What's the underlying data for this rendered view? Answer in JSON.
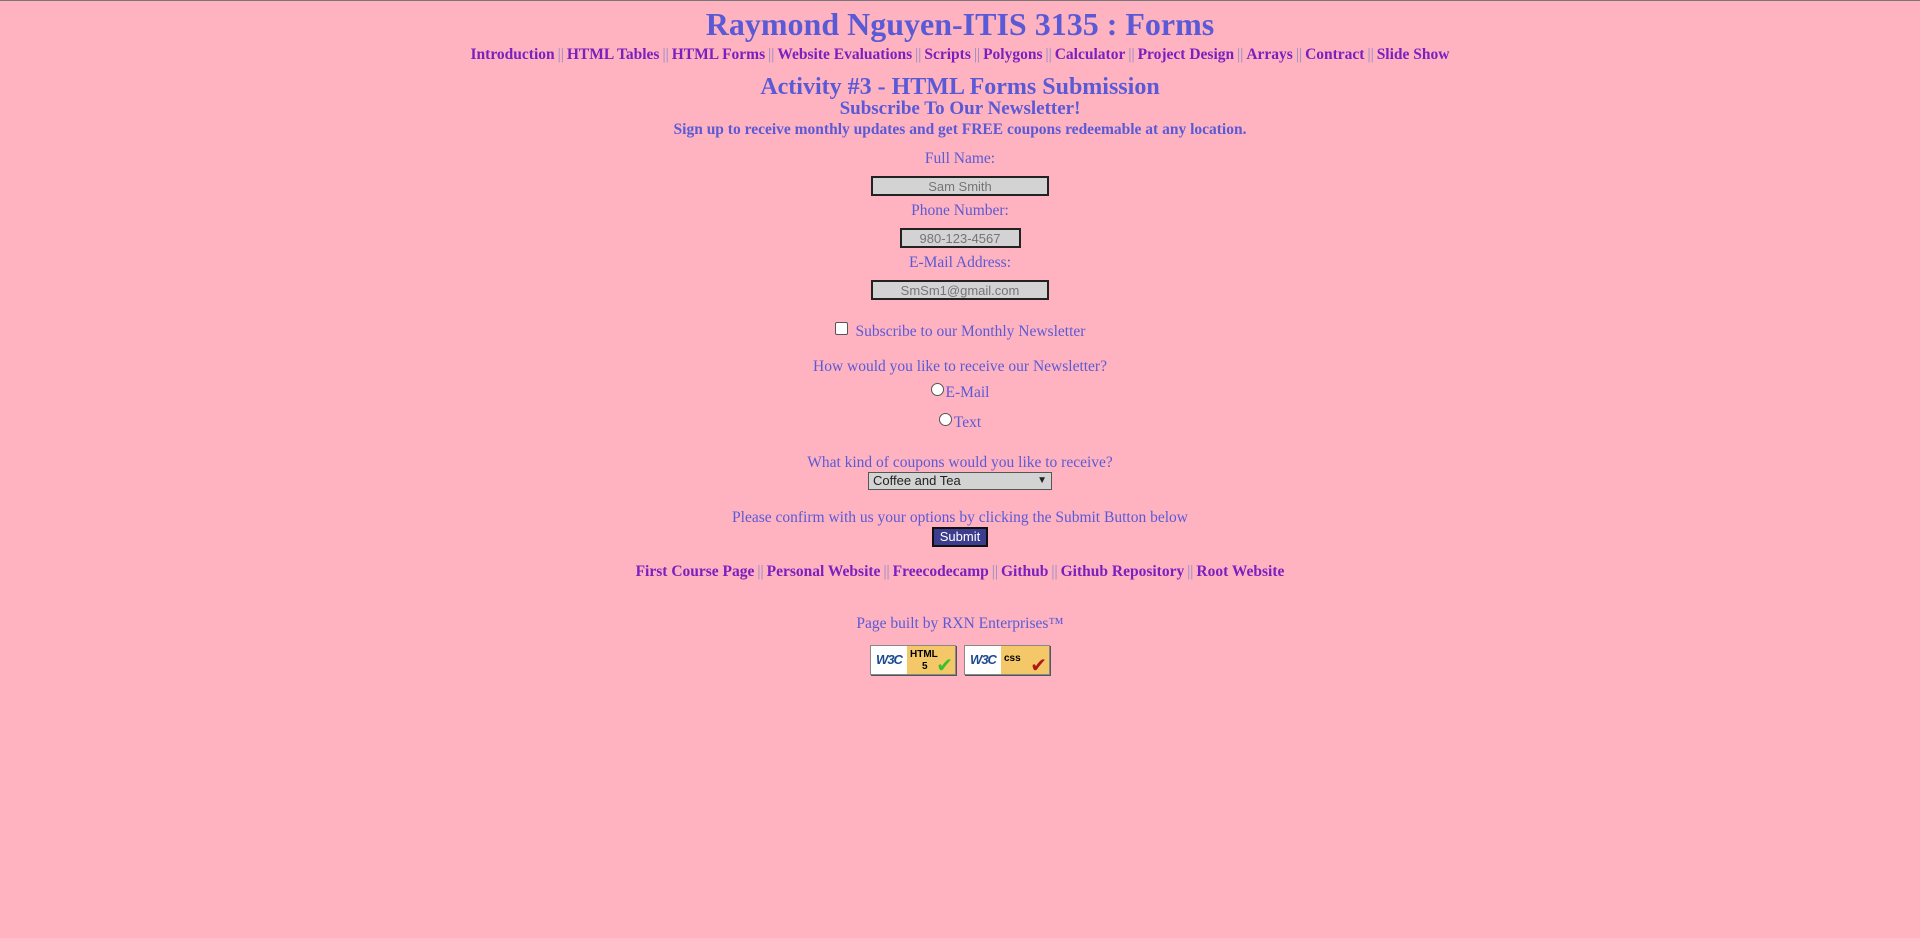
{
  "header": {
    "title": "Raymond Nguyen-ITIS 3135 : Forms"
  },
  "nav": {
    "separator": "||",
    "items": [
      {
        "label": "Introduction"
      },
      {
        "label": "HTML Tables"
      },
      {
        "label": "HTML Forms"
      },
      {
        "label": "Website Evaluations"
      },
      {
        "label": "Scripts"
      },
      {
        "label": "Polygons"
      },
      {
        "label": "Calculator"
      },
      {
        "label": "Project Design"
      },
      {
        "label": "Arrays"
      },
      {
        "label": "Contract"
      },
      {
        "label": "Slide Show"
      }
    ]
  },
  "main": {
    "activity_title": "Activity #3 - HTML Forms Submission",
    "subheading": "Subscribe To Our Newsletter!",
    "intro": "Sign up to receive monthly updates and get FREE coupons redeemable at any location."
  },
  "form": {
    "full_name": {
      "label": "Full Name:",
      "placeholder": "Sam Smith"
    },
    "phone": {
      "label": "Phone Number:",
      "placeholder": "980-123-4567"
    },
    "email": {
      "label": "E-Mail Address:",
      "placeholder": "SmSm1@gmail.com"
    },
    "subscribe_checkbox": {
      "label": "Subscribe to our Monthly Newsletter",
      "checked": false
    },
    "delivery_question": "How would you like to receive our Newsletter?",
    "delivery_options": [
      {
        "label": "E-Mail",
        "selected": false
      },
      {
        "label": "Text",
        "selected": false
      }
    ],
    "coupon_question": "What kind of coupons would you like to receive?",
    "coupon_selected": "Coffee and Tea",
    "confirm_text": "Please confirm with us your options by clicking the Submit Button below",
    "submit_label": "Submit"
  },
  "footer": {
    "separator": "||",
    "links": [
      {
        "label": "First Course Page"
      },
      {
        "label": "Personal Website"
      },
      {
        "label": "Freecodecamp"
      },
      {
        "label": "Github"
      },
      {
        "label": "Github Repository"
      },
      {
        "label": "Root Website"
      }
    ],
    "built_by": "Page built by RXN Enterprises™",
    "badges": [
      {
        "org": "W3C",
        "tag_line1": "HTML",
        "tag_line2": "5",
        "tick_color": "#3bbf2f",
        "icon": "html5-valid-badge"
      },
      {
        "org": "W3C",
        "tag_line1": "css",
        "tag_line2": "",
        "tick_color": "#b01818",
        "icon": "css-valid-badge"
      }
    ]
  },
  "colors": {
    "background": "#ffb3c0",
    "text": "#5a5ad6",
    "link": "#7b1fbf",
    "submit_bg": "#3d3d8f"
  }
}
